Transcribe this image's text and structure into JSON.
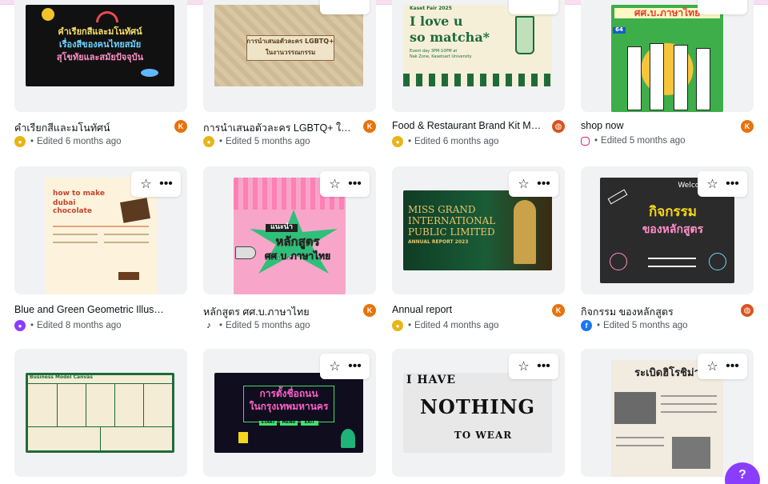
{
  "colors": {
    "accent": "#8b3dff",
    "owner_orange": "#e8720c",
    "background": "#ffffff"
  },
  "cards": [
    {
      "title": "คำเรียกสีและมโนทัศน์",
      "source_icon": "canva-icon",
      "edited": "Edited 6 months ago",
      "owner": "K",
      "thumb_text": [
        "คำเรียกสีและมโนทัศน์",
        "เรื่องสีของคนไทยสมัย",
        "สุโขทัยและสมัยปัจจุบัน"
      ]
    },
    {
      "title": "การนำเสนอตัวละคร LGBTQ+ ในงานวรรณกรรม",
      "source_icon": "canva-icon",
      "edited": "Edited 5 months ago",
      "owner": "K",
      "thumb_text": [
        "การนำเสนอตัวละคร LGBTQ+",
        "ในงานวรรณกรรม"
      ]
    },
    {
      "title": "Food & Restaurant Brand Kit Mobile Video",
      "source_icon": "canva-icon",
      "edited": "Edited 6 months ago",
      "owner": "ball",
      "thumb_text": [
        "Kaset Fair 2025",
        "I love u",
        "so matcha*",
        "Event day 3PM-10PM at",
        "Nak Zone, Kasetsart University"
      ]
    },
    {
      "title": "shop now",
      "source_icon": "instagram-icon",
      "edited": "Edited 5 months ago",
      "owner": "K",
      "thumb_text": [
        "ศศ.บ.ภาษาไทย",
        "64"
      ]
    },
    {
      "title": "Blue and Green Geometric Illustrative Poster",
      "source_icon": "canva-icon",
      "edited": "Edited 8 months ago",
      "owner": "",
      "thumb_text": [
        "how to make",
        "dubai chocolate"
      ]
    },
    {
      "title": "หลักสูตร ศศ.บ.ภาษาไทย",
      "source_icon": "tiktok-icon",
      "edited": "Edited 5 months ago",
      "owner": "K",
      "thumb_text": [
        "แนะนำ",
        "หลักสูตร",
        "ศศ.บ.ภาษาไทย"
      ]
    },
    {
      "title": "Annual report",
      "source_icon": "canva-icon",
      "edited": "Edited 4 months ago",
      "owner": "K",
      "thumb_text": [
        "MISS GRAND",
        "INTERNATIONAL",
        "PUBLIC LIMITED",
        "ANNUAL REPORT 2023"
      ]
    },
    {
      "title": "กิจกรรม ของหลักสูตร",
      "source_icon": "facebook-icon",
      "edited": "Edited 5 months ago",
      "owner": "ball",
      "thumb_text": [
        "Welcome",
        "กิจกรรม",
        "ของหลักสูตร"
      ]
    },
    {
      "title": "",
      "source_icon": "",
      "edited": "",
      "owner": "",
      "thumb_text": [
        "Business Model Canvas"
      ]
    },
    {
      "title": "",
      "source_icon": "",
      "edited": "",
      "owner": "",
      "thumb_text": [
        "การตั้งชื่อถนน",
        "ในกรุงเทพมหานคร",
        "START",
        "MENU",
        "EXIT"
      ]
    },
    {
      "title": "",
      "source_icon": "",
      "edited": "",
      "owner": "",
      "thumb_text": [
        "I HAVE",
        "NOTHING",
        "TO WEAR"
      ]
    },
    {
      "title": "",
      "source_icon": "",
      "edited": "",
      "owner": "",
      "thumb_text": [
        "ระเบิดฮิโรชิม่า"
      ]
    }
  ],
  "help_button": "?"
}
